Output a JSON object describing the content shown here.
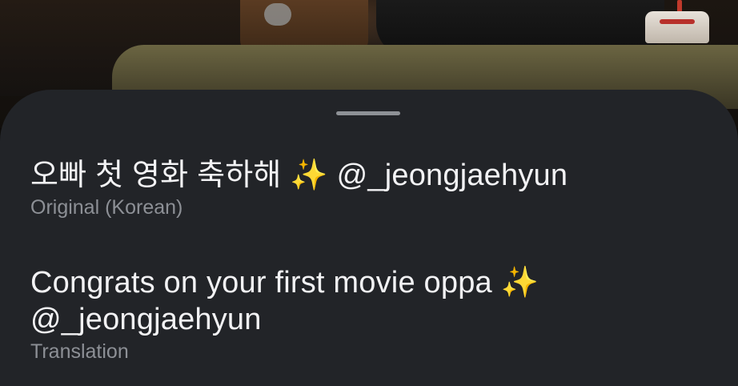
{
  "original": {
    "text": "오빠 첫 영화 축하해",
    "sparkle": "✨",
    "mention": "@_jeongjaehyun",
    "label": "Original (Korean)"
  },
  "translation": {
    "text": "Congrats on your first movie oppa",
    "sparkle": "✨",
    "mention": "@_jeongjaehyun",
    "label": "Translation"
  },
  "colors": {
    "sheet": "#222428",
    "primary_text": "#f2f2f4",
    "secondary_text": "#8d9096",
    "grabber": "#8e9196"
  },
  "icons": {
    "sparkle": "sparkles-emoji"
  }
}
